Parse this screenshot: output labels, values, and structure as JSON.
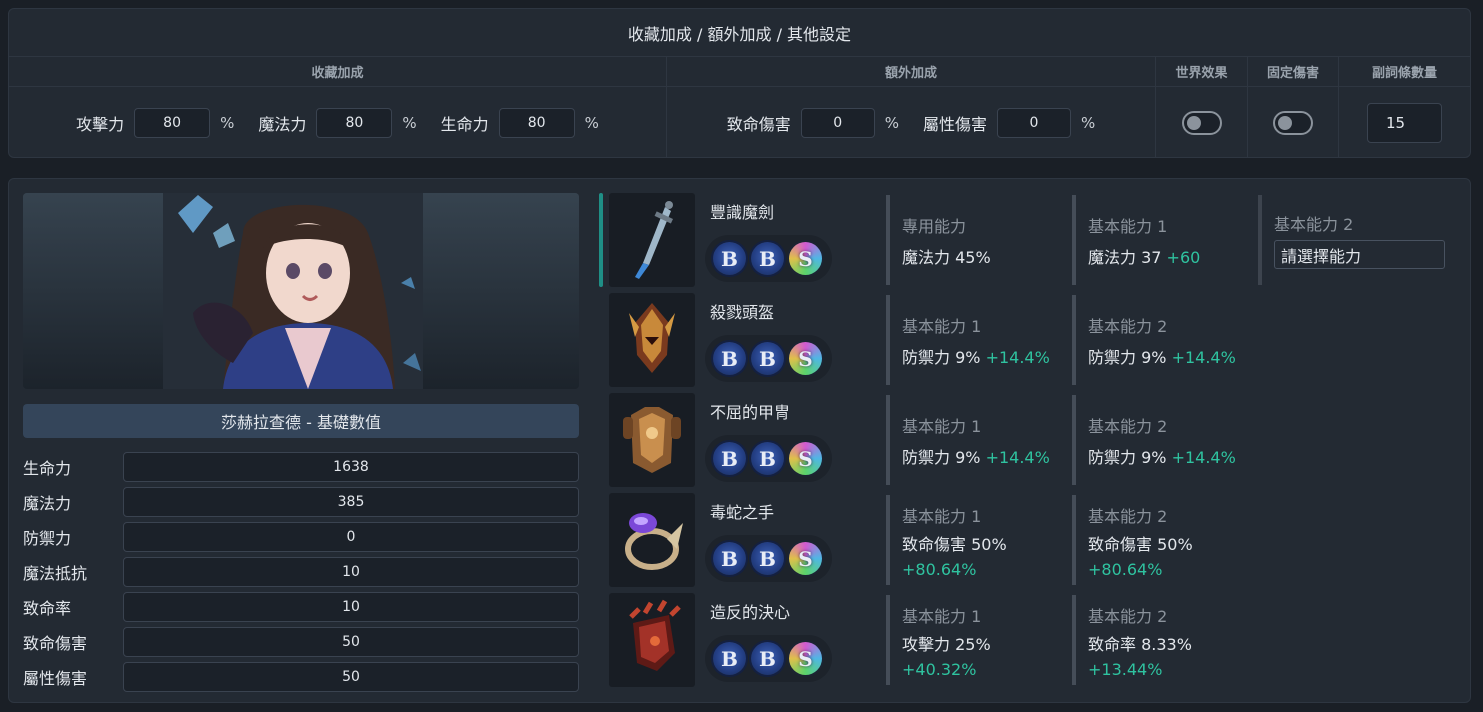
{
  "top_panel": {
    "title": "收藏加成 / 額外加成 / 其他設定",
    "collection": {
      "header": "收藏加成",
      "fields": [
        {
          "label": "攻擊力",
          "value": "80",
          "unit": "%"
        },
        {
          "label": "魔法力",
          "value": "80",
          "unit": "%"
        },
        {
          "label": "生命力",
          "value": "80",
          "unit": "%"
        }
      ]
    },
    "extra": {
      "header": "額外加成",
      "fields": [
        {
          "label": "致命傷害",
          "value": "0",
          "unit": "%"
        },
        {
          "label": "屬性傷害",
          "value": "0",
          "unit": "%"
        }
      ]
    },
    "world_effect": {
      "header": "世界效果",
      "enabled": false
    },
    "fixed_damage": {
      "header": "固定傷害",
      "enabled": false
    },
    "substat_count": {
      "header": "副詞條數量",
      "value": "15"
    }
  },
  "character": {
    "name": "莎赫拉查德 - 基礎數值",
    "stats": [
      {
        "label": "生命力",
        "value": "1638"
      },
      {
        "label": "魔法力",
        "value": "385"
      },
      {
        "label": "防禦力",
        "value": "0"
      },
      {
        "label": "魔法抵抗",
        "value": "10"
      },
      {
        "label": "致命率",
        "value": "10"
      },
      {
        "label": "致命傷害",
        "value": "50"
      },
      {
        "label": "屬性傷害",
        "value": "50"
      }
    ]
  },
  "equipment": [
    {
      "name": "豐識魔劍",
      "icon": "sword-icon",
      "runes": [
        "B",
        "B",
        "S"
      ],
      "abilities": [
        {
          "title": "專用能力",
          "value": "魔法力 45%",
          "bonus": ""
        },
        {
          "title": "基本能力 1",
          "value": "魔法力 37",
          "bonus": "+60"
        },
        {
          "title": "基本能力 2",
          "select_placeholder": "請選擇能力"
        }
      ]
    },
    {
      "name": "殺戮頭盔",
      "icon": "helmet-icon",
      "runes": [
        "B",
        "B",
        "S"
      ],
      "abilities": [
        {
          "title": "基本能力 1",
          "value": "防禦力 9%",
          "bonus": "+14.4%"
        },
        {
          "title": "基本能力 2",
          "value": "防禦力 9%",
          "bonus": "+14.4%"
        }
      ]
    },
    {
      "name": "不屈的甲冑",
      "icon": "armor-icon",
      "runes": [
        "B",
        "B",
        "S"
      ],
      "abilities": [
        {
          "title": "基本能力 1",
          "value": "防禦力 9%",
          "bonus": "+14.4%"
        },
        {
          "title": "基本能力 2",
          "value": "防禦力 9%",
          "bonus": "+14.4%"
        }
      ]
    },
    {
      "name": "毒蛇之手",
      "icon": "ring-icon",
      "runes": [
        "B",
        "B",
        "S"
      ],
      "abilities": [
        {
          "title": "基本能力 1",
          "value": "致命傷害 50%",
          "bonus": "+80.64%"
        },
        {
          "title": "基本能力 2",
          "value": "致命傷害 50%",
          "bonus": "+80.64%"
        }
      ]
    },
    {
      "name": "造反的決心",
      "icon": "gauntlet-icon",
      "runes": [
        "B",
        "B",
        "S"
      ],
      "abilities": [
        {
          "title": "基本能力 1",
          "value": "攻擊力 25%",
          "bonus": "+40.32%"
        },
        {
          "title": "基本能力 2",
          "value": "致命率 8.33%",
          "bonus": "+13.44%"
        }
      ]
    }
  ]
}
